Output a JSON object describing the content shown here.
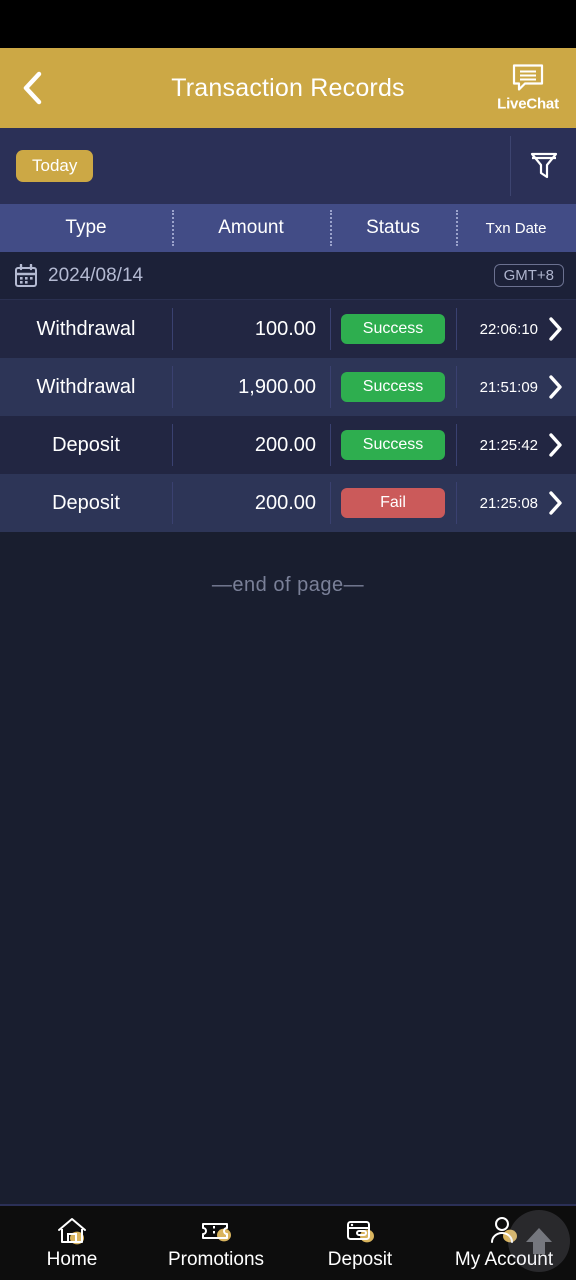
{
  "header": {
    "title": "Transaction Records",
    "back_icon": "chevron-left-icon",
    "livechat_label": "LiveChat",
    "livechat_icon": "chat-bubble-icon",
    "bg_color": "#cca845"
  },
  "filter_bar": {
    "chip_label": "Today",
    "filter_icon": "funnel-icon"
  },
  "table": {
    "columns": [
      "Type",
      "Amount",
      "Status",
      "Txn Date"
    ],
    "date_group": {
      "calendar_icon": "calendar-icon",
      "date": "2024/08/14",
      "timezone": "GMT+8"
    },
    "rows": [
      {
        "type": "Withdrawal",
        "amount": "100.00",
        "status": "Success",
        "status_kind": "success",
        "time": "22:06:10",
        "chevron": "chevron-right-icon"
      },
      {
        "type": "Withdrawal",
        "amount": "1,900.00",
        "status": "Success",
        "status_kind": "success",
        "time": "21:51:09",
        "chevron": "chevron-right-icon"
      },
      {
        "type": "Deposit",
        "amount": "200.00",
        "status": "Success",
        "status_kind": "success",
        "time": "21:25:42",
        "chevron": "chevron-right-icon"
      },
      {
        "type": "Deposit",
        "amount": "200.00",
        "status": "Fail",
        "status_kind": "fail",
        "time": "21:25:08",
        "chevron": "chevron-right-icon"
      }
    ],
    "end_of_page": "—end of page—"
  },
  "colors": {
    "accent_gold": "#cca845",
    "success_green": "#2eae4f",
    "fail_red": "#cb5a5a",
    "page_bg": "#191e2f",
    "header_row_bg": "#424c86"
  },
  "bottom_nav": [
    {
      "label": "Home",
      "icon": "home-icon"
    },
    {
      "label": "Promotions",
      "icon": "ticket-icon"
    },
    {
      "label": "Deposit",
      "icon": "wallet-icon"
    },
    {
      "label": "My Account",
      "icon": "user-icon"
    }
  ],
  "scroll_top_button": {
    "icon": "arrow-up-icon"
  }
}
